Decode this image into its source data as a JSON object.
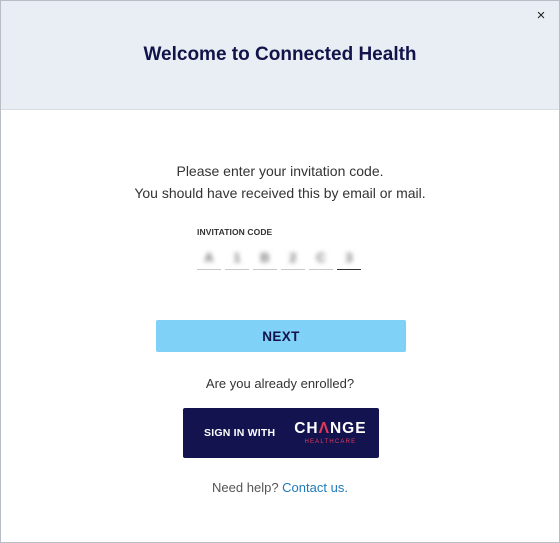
{
  "header": {
    "title": "Welcome to Connected Health",
    "close_glyph": "×"
  },
  "instructions": {
    "line1": "Please enter your invitation code.",
    "line2": "You should have received this by email or mail."
  },
  "invitation": {
    "label": "INVITATION CODE",
    "boxes": [
      "A",
      "1",
      "B",
      "2",
      "C",
      "3"
    ]
  },
  "next_button": {
    "label": "NEXT"
  },
  "enrolled": {
    "text": "Are you already enrolled?"
  },
  "signin": {
    "label": "SIGN IN WITH",
    "brand_pre": "CH",
    "brand_accent": "Λ",
    "brand_post": "NGE",
    "brand_sub": "HEALTHCARE"
  },
  "help": {
    "prefix": "Need help?",
    "link": "Contact us."
  },
  "colors": {
    "header_bg": "#e8eef3",
    "title": "#13134a",
    "next_bg": "#7fd1f7",
    "signin_bg": "#13134f",
    "brand_accent": "#e03a5a",
    "link": "#1f7ab8"
  }
}
